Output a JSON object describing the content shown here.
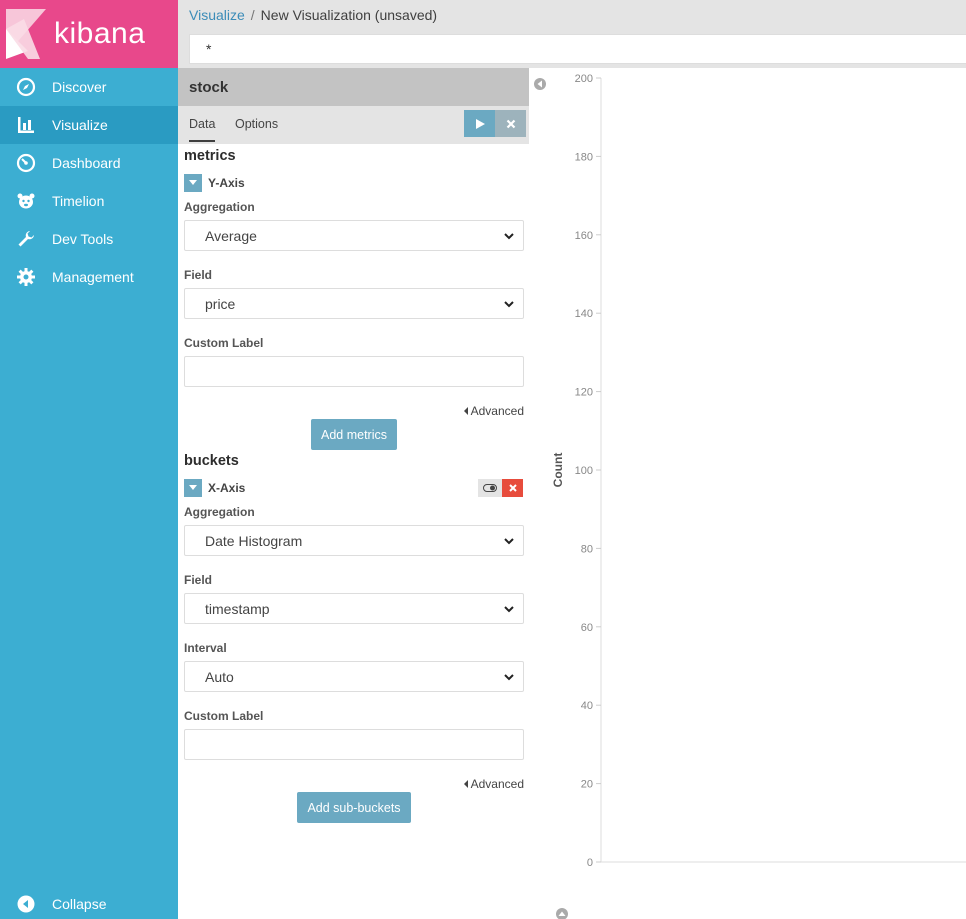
{
  "sidebar": {
    "brand": "kibana",
    "items": [
      {
        "label": "Discover",
        "icon": "compass-icon"
      },
      {
        "label": "Visualize",
        "icon": "bar-chart-icon",
        "active": true
      },
      {
        "label": "Dashboard",
        "icon": "dashboard-gauge-icon"
      },
      {
        "label": "Timelion",
        "icon": "timelion-bear-icon"
      },
      {
        "label": "Dev Tools",
        "icon": "wrench-icon"
      },
      {
        "label": "Management",
        "icon": "gear-icon"
      }
    ],
    "collapse_label": "Collapse"
  },
  "header": {
    "breadcrumb_link": "Visualize",
    "breadcrumb_sep": "/",
    "breadcrumb_current": "New Visualization (unsaved)",
    "query_value": "*"
  },
  "editor": {
    "index_title": "stock",
    "tabs": [
      {
        "label": "Data",
        "active": true
      },
      {
        "label": "Options"
      }
    ],
    "metrics": {
      "heading": "metrics",
      "agg_title": "Y-Axis",
      "aggregation_label": "Aggregation",
      "aggregation_value": "Average",
      "field_label": "Field",
      "field_value": "price",
      "custom_label": "Custom Label",
      "custom_value": "",
      "advanced": "Advanced",
      "add_button": "Add metrics"
    },
    "buckets": {
      "heading": "buckets",
      "agg_title": "X-Axis",
      "aggregation_label": "Aggregation",
      "aggregation_value": "Date Histogram",
      "field_label": "Field",
      "field_value": "timestamp",
      "interval_label": "Interval",
      "interval_value": "Auto",
      "custom_label": "Custom Label",
      "custom_value": "",
      "advanced": "Advanced",
      "add_button": "Add sub-buckets"
    }
  },
  "colors": {
    "sidebar": "#3caed2",
    "sidebar_active": "#2a9bc2",
    "brand": "#e8488b",
    "button": "#6ba9c2",
    "danger": "#e74c3c"
  },
  "chart_data": {
    "type": "line",
    "ylabel": "Count",
    "ylim": [
      0,
      200
    ],
    "yticks": [
      0,
      20,
      40,
      60,
      80,
      100,
      120,
      140,
      160,
      180,
      200
    ],
    "series": []
  }
}
